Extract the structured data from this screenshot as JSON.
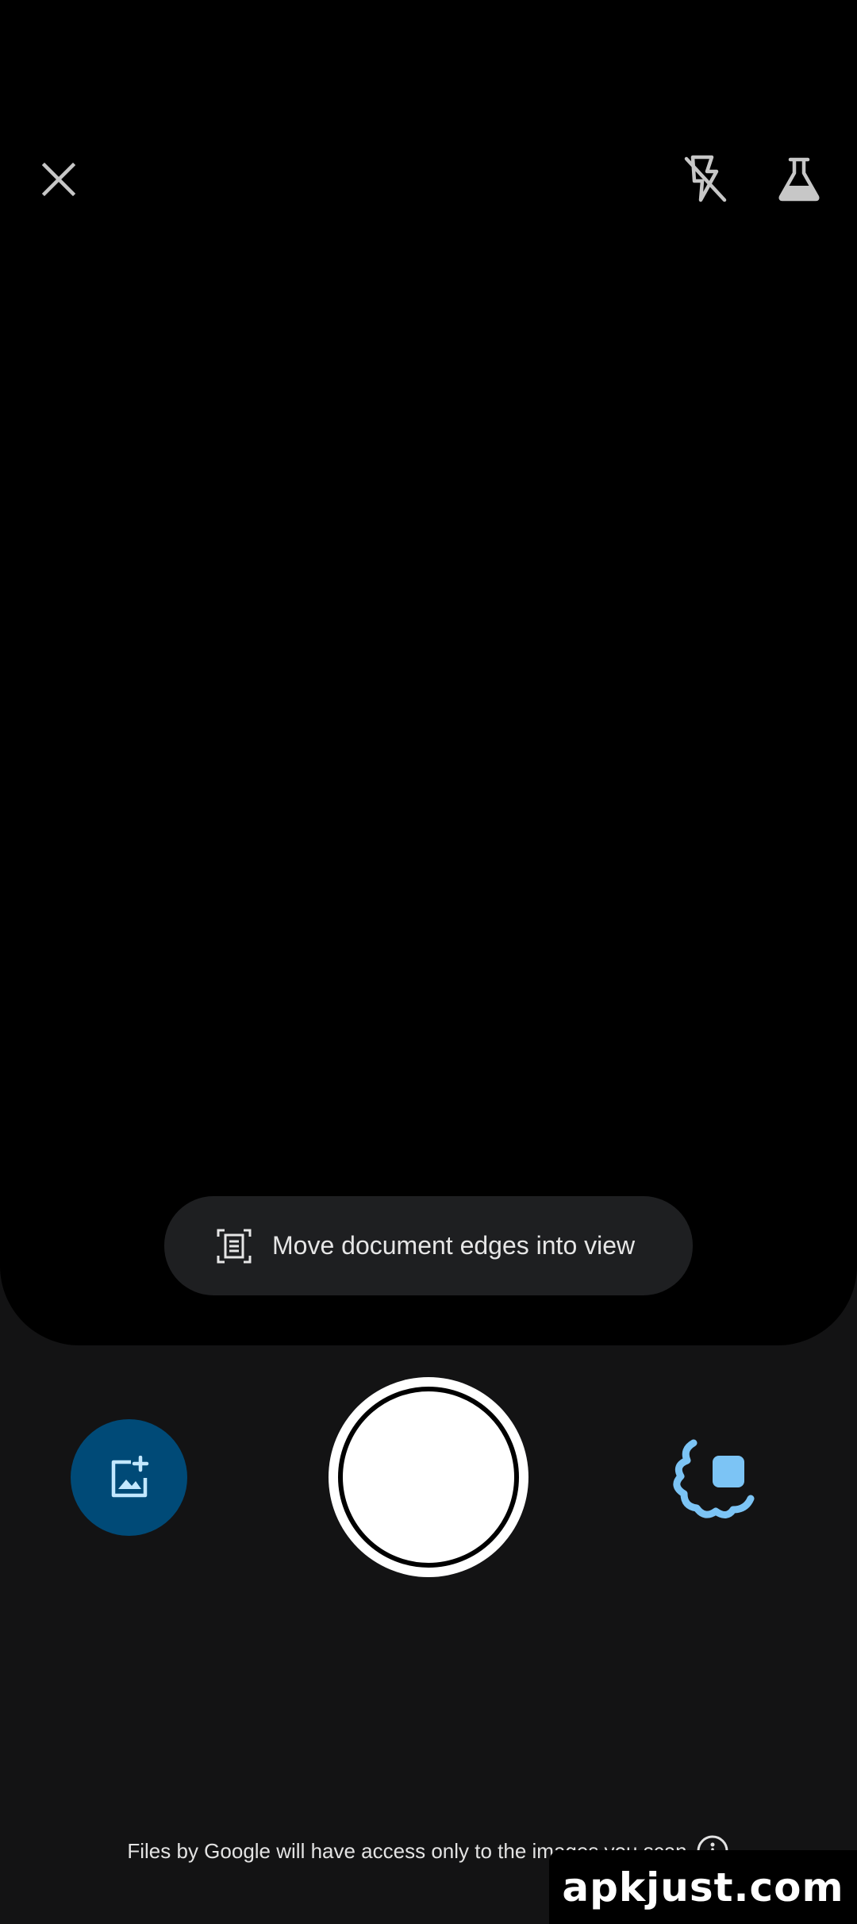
{
  "top_bar": {
    "close_icon": "close-icon",
    "flash_icon": "flash-off-icon",
    "labs_icon": "flask-icon"
  },
  "hint": {
    "icon": "document-scan-icon",
    "text": "Move document edges into view"
  },
  "controls": {
    "gallery_icon": "add-photo-icon",
    "gallery_color": "#004a77",
    "mode_icon": "auto-capture-icon",
    "mode_color": "#7cc4f5"
  },
  "footer": {
    "text": "Files by Google will have access only to the images you scan",
    "icon": "info-icon"
  },
  "watermark": {
    "text": "apkjust.com"
  }
}
